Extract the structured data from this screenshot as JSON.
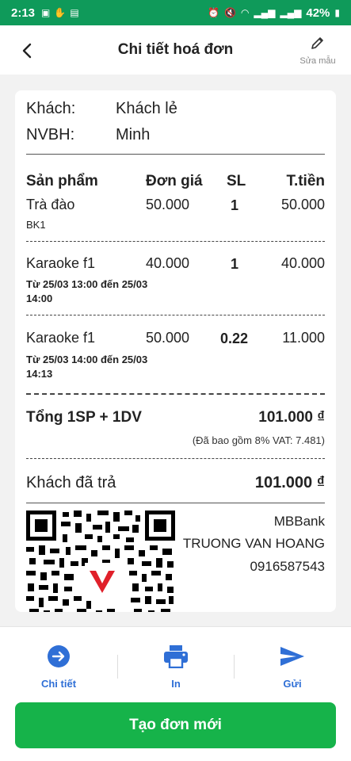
{
  "status": {
    "time": "2:13",
    "battery": "42%",
    "net": "Vo))\nLTE1"
  },
  "header": {
    "title": "Chi tiết hoá đơn",
    "edit_label": "Sửa mẫu"
  },
  "customer": {
    "label": "Khách:",
    "value": "Khách lẻ"
  },
  "staff": {
    "label": "NVBH:",
    "value": "Minh"
  },
  "table": {
    "headers": [
      "Sản phẩm",
      "Đơn giá",
      "SL",
      "T.tiền"
    ],
    "rows": [
      {
        "name": "Trà đào",
        "price": "50.000",
        "qty": "1",
        "amount": "50.000",
        "note": "BK1"
      },
      {
        "name": "Karaoke f1",
        "price": "40.000",
        "qty": "1",
        "amount": "40.000",
        "note": "Từ 25/03 13:00 đến 25/03 14:00"
      },
      {
        "name": "Karaoke f1",
        "price": "50.000",
        "qty": "0.22",
        "amount": "11.000",
        "note": "Từ 25/03 14:00 đến 25/03 14:13"
      }
    ]
  },
  "total": {
    "label": "Tổng 1SP + 1DV",
    "value": "101.000 ₫",
    "vat_note": "(Đã bao gồm 8% VAT: 7.481)"
  },
  "paid": {
    "label": "Khách đã trả",
    "value": "101.000 ₫"
  },
  "bank": {
    "name": "MBBank",
    "account_name": "TRUONG VAN HOANG",
    "account_number": "0916587543"
  },
  "tabs": [
    {
      "label": "Chi tiết",
      "icon": "arrow-circle-right-icon"
    },
    {
      "label": "In",
      "icon": "printer-icon"
    },
    {
      "label": "Gửi",
      "icon": "send-icon"
    }
  ],
  "create_button": "Tạo đơn mới",
  "colors": {
    "primary_green": "#16b34a",
    "status_green": "#0f9a5a",
    "tab_blue": "#2f6fd6"
  }
}
